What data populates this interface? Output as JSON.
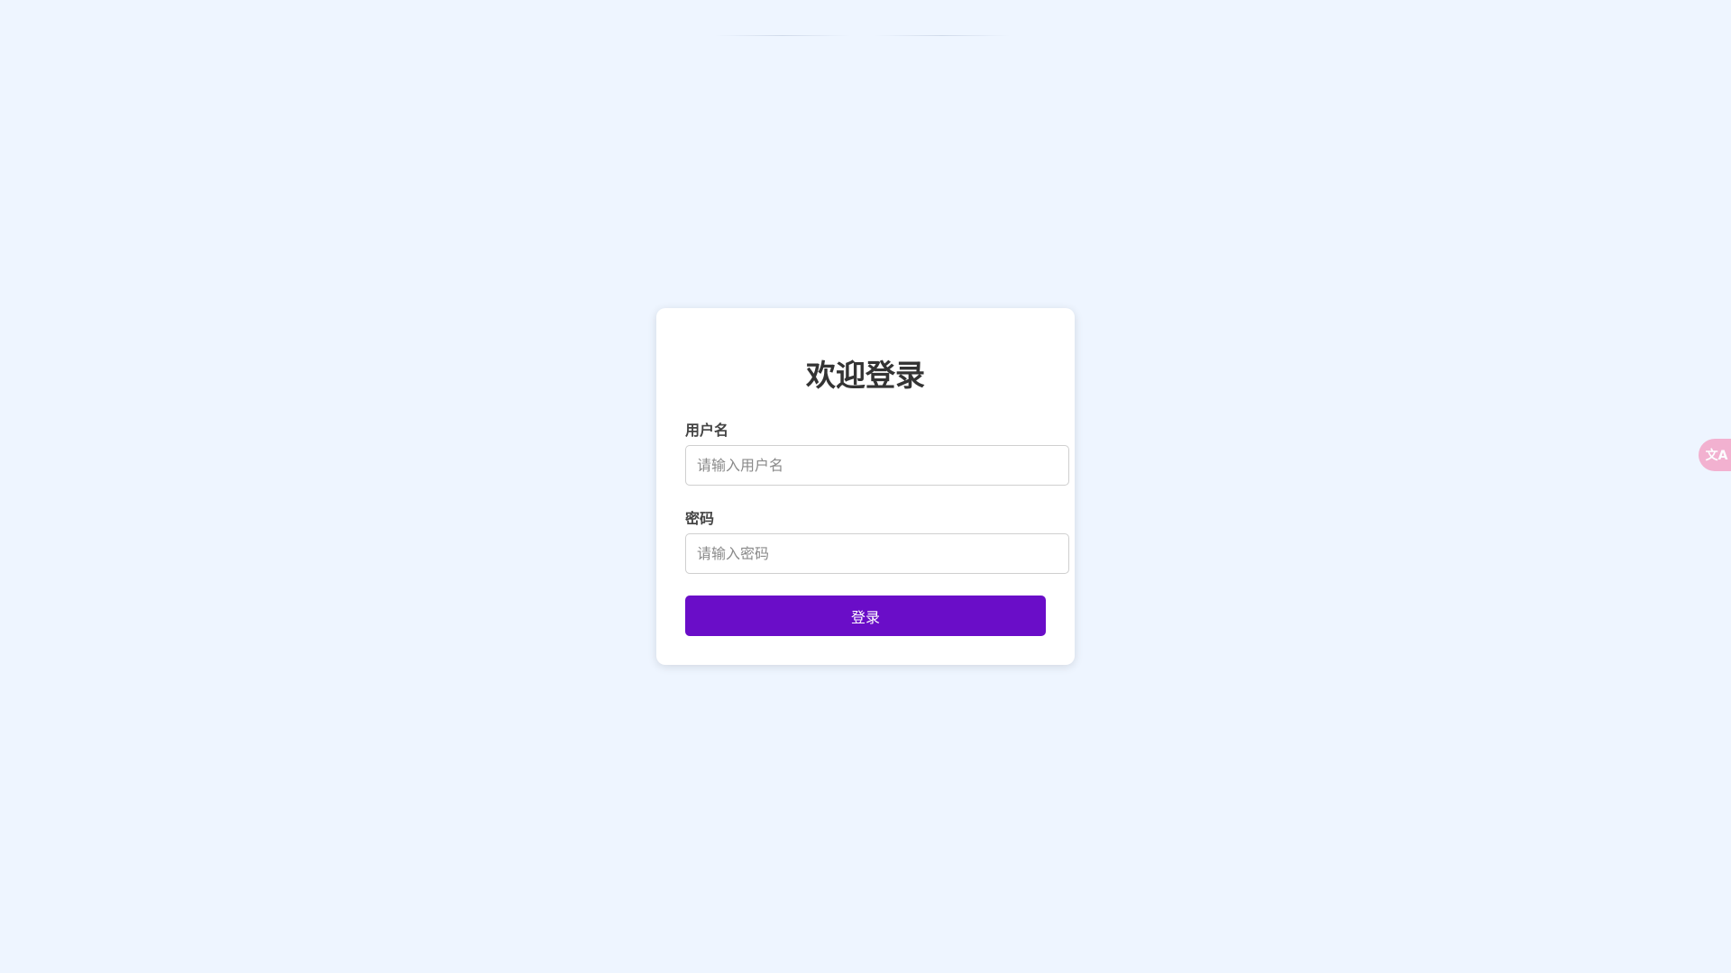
{
  "login": {
    "title": "欢迎登录",
    "username": {
      "label": "用户名",
      "placeholder": "请输入用户名",
      "value": ""
    },
    "password": {
      "label": "密码",
      "placeholder": "请输入密码",
      "value": ""
    },
    "submit_label": "登录"
  },
  "translate_widget": {
    "icon": "translate-icon",
    "glyph": "文A"
  },
  "colors": {
    "background": "#eef5ff",
    "card": "#ffffff",
    "primary_button": "#6a0dc8",
    "translate_fab": "#f3a6c8"
  }
}
